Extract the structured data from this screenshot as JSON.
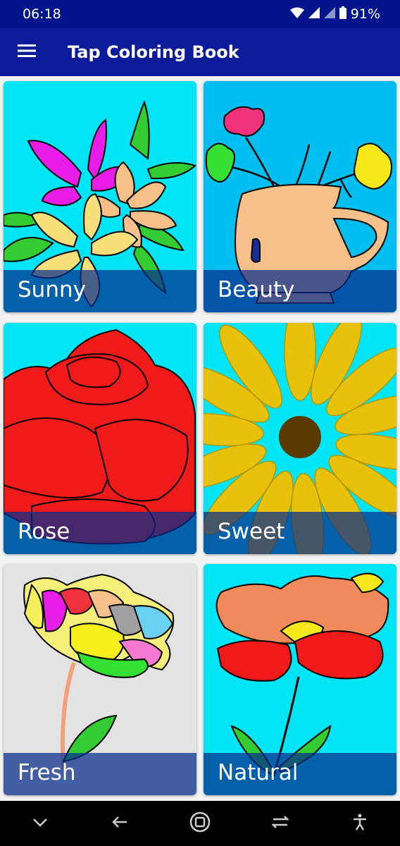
{
  "status_bar": {
    "time": "06:18",
    "battery": "91%"
  },
  "app_bar": {
    "title": "Tap Coloring Book"
  },
  "cards": [
    {
      "label": "Sunny"
    },
    {
      "label": "Beauty"
    },
    {
      "label": "Rose"
    },
    {
      "label": "Sweet"
    },
    {
      "label": "Fresh"
    },
    {
      "label": "Natural"
    }
  ],
  "colors": {
    "status_bar": "#00158c",
    "app_bar": "#0b1b99",
    "card_bg_cyan": "#00e5f5",
    "card_bg_blue": "#00bff0",
    "card_bg_gray": "#e3e3e3",
    "label_overlay": "rgba(5,45,140,0.72)"
  }
}
